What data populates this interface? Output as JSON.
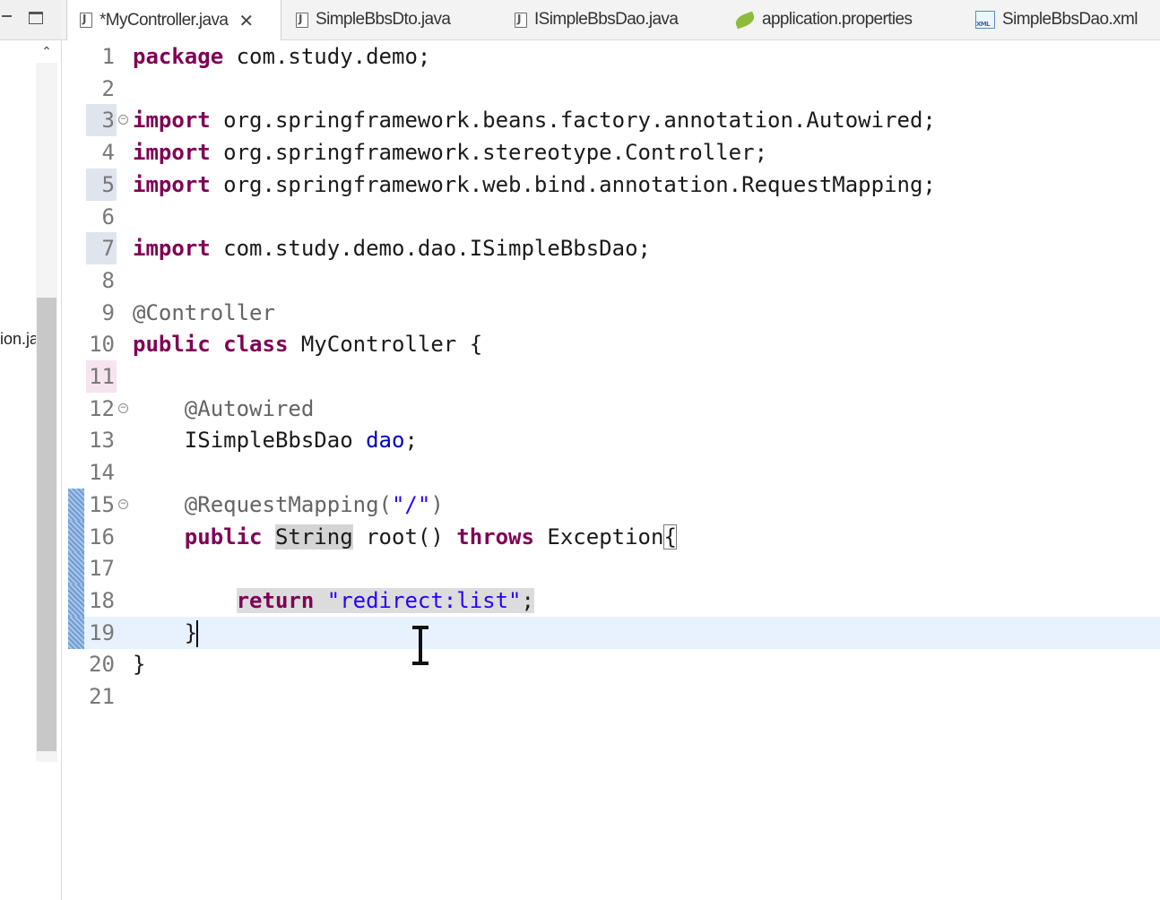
{
  "explorer": {
    "truncated_text": "ion.ja"
  },
  "tabs": [
    {
      "label": "*MyController.java",
      "icon": "java-file-icon",
      "active": true
    },
    {
      "label": "SimpleBbsDto.java",
      "icon": "java-file-icon",
      "active": false
    },
    {
      "label": "ISimpleBbsDao.java",
      "icon": "java-file-icon",
      "active": false
    },
    {
      "label": "application.properties",
      "icon": "properties-leaf-icon",
      "active": false
    },
    {
      "label": "SimpleBbsDao.xml",
      "icon": "xml-file-icon",
      "active": false
    }
  ],
  "editor": {
    "lines": [
      {
        "n": "1",
        "code": [
          [
            "kw",
            "package"
          ],
          [
            "t",
            " com.study.demo;"
          ]
        ]
      },
      {
        "n": "2",
        "code": []
      },
      {
        "n": "3",
        "code": [
          [
            "kw",
            "import"
          ],
          [
            "t",
            " org.springframework.beans.factory.annotation.Autowired;"
          ]
        ]
      },
      {
        "n": "4",
        "code": [
          [
            "kw",
            "import"
          ],
          [
            "t",
            " org.springframework.stereotype.Controller;"
          ]
        ]
      },
      {
        "n": "5",
        "code": [
          [
            "kw",
            "import"
          ],
          [
            "t",
            " org.springframework.web.bind.annotation.RequestMapping;"
          ]
        ]
      },
      {
        "n": "6",
        "code": []
      },
      {
        "n": "7",
        "code": [
          [
            "kw",
            "import"
          ],
          [
            "t",
            " com.study.demo.dao.ISimpleBbsDao;"
          ]
        ]
      },
      {
        "n": "8",
        "code": []
      },
      {
        "n": "9",
        "code": [
          [
            "ann",
            "@Controller"
          ]
        ]
      },
      {
        "n": "10",
        "code": [
          [
            "kw",
            "public"
          ],
          [
            "t",
            " "
          ],
          [
            "kw",
            "class"
          ],
          [
            "t",
            " MyController {"
          ]
        ]
      },
      {
        "n": "11",
        "code": []
      },
      {
        "n": "12",
        "code": [
          [
            "t",
            "    "
          ],
          [
            "ann",
            "@Autowired"
          ]
        ]
      },
      {
        "n": "13",
        "code": [
          [
            "t",
            "    ISimpleBbsDao "
          ],
          [
            "fld",
            "dao"
          ],
          [
            "t",
            ";"
          ]
        ]
      },
      {
        "n": "14",
        "code": []
      },
      {
        "n": "15",
        "code": [
          [
            "t",
            "    "
          ],
          [
            "ann",
            "@RequestMapping("
          ],
          [
            "str",
            "\"/\""
          ],
          [
            "ann",
            ")"
          ]
        ]
      },
      {
        "n": "16",
        "code": [
          [
            "t",
            "    "
          ],
          [
            "kw",
            "public"
          ],
          [
            "t",
            " "
          ],
          [
            "occ",
            "String"
          ],
          [
            "t",
            " root() "
          ],
          [
            "kw",
            "throws"
          ],
          [
            "t",
            " Exception"
          ],
          [
            "bracket",
            "{"
          ]
        ]
      },
      {
        "n": "17",
        "code": []
      },
      {
        "n": "18",
        "code": [
          [
            "t",
            "        "
          ],
          [
            "selkw",
            "return"
          ],
          [
            "sel",
            " "
          ],
          [
            "selstr",
            "\"redirect:list\""
          ],
          [
            "sel",
            ";"
          ]
        ]
      },
      {
        "n": "19",
        "code": [
          [
            "t",
            "    }"
          ],
          [
            "caret",
            ""
          ]
        ]
      },
      {
        "n": "20",
        "code": [
          [
            "t",
            "}"
          ]
        ]
      },
      {
        "n": "21",
        "code": []
      }
    ]
  }
}
